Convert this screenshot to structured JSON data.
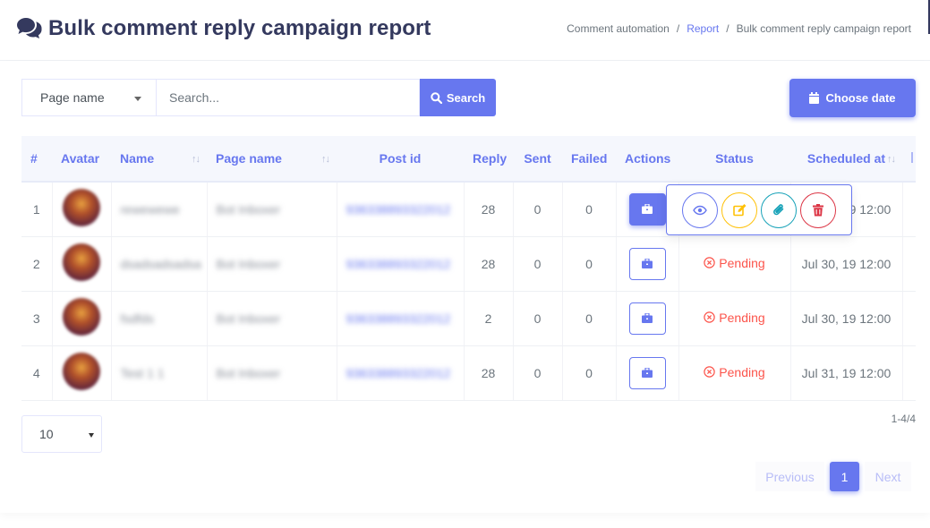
{
  "header": {
    "title": "Bulk comment reply campaign report",
    "title_icon": "comments-icon",
    "breadcrumb": [
      {
        "label": "Comment automation",
        "link": false
      },
      {
        "label": "Report",
        "link": true
      },
      {
        "label": "Bulk comment reply campaign report",
        "link": false
      }
    ],
    "separator": "/"
  },
  "filters": {
    "page_select": "Page name",
    "search_placeholder": "Search...",
    "search_label": "Search",
    "date_label": "Choose date"
  },
  "table": {
    "columns": [
      "#",
      "Avatar",
      "Name",
      "Page name",
      "Post id",
      "Reply",
      "Sent",
      "Failed",
      "Actions",
      "Status",
      "Scheduled at"
    ],
    "rows": [
      {
        "num": "1",
        "name": "rewewewe",
        "page": "Bot Inboxer",
        "post_id": "936338893322012",
        "reply": "28",
        "sent": "0",
        "failed": "0",
        "status": "",
        "scheduled": "Jul 30, 19 12:00"
      },
      {
        "num": "2",
        "name": "dsadsadsadsa",
        "page": "Bot Inboxer",
        "post_id": "936338893322012",
        "reply": "28",
        "sent": "0",
        "failed": "0",
        "status": "Pending",
        "scheduled": "Jul 30, 19 12:00"
      },
      {
        "num": "3",
        "name": "fsdfds",
        "page": "Bot Inboxer",
        "post_id": "936338893322012",
        "reply": "2",
        "sent": "0",
        "failed": "0",
        "status": "Pending",
        "scheduled": "Jul 30, 19 12:00"
      },
      {
        "num": "4",
        "name": "Test 1 1",
        "page": "Bot Inboxer",
        "post_id": "936338893322012",
        "reply": "28",
        "sent": "0",
        "failed": "0",
        "status": "Pending",
        "scheduled": "Jul 31, 19 12:00"
      }
    ]
  },
  "popover_actions": [
    {
      "icon": "eye-icon",
      "color": "#6777ef"
    },
    {
      "icon": "edit-icon",
      "color": "#ffc107"
    },
    {
      "icon": "paperclip-icon",
      "color": "#17a2b8"
    },
    {
      "icon": "trash-icon",
      "color": "#dc3545"
    }
  ],
  "pagination": {
    "per_page": "10",
    "count": "1-4/4",
    "previous": "Previous",
    "current": "1",
    "next": "Next"
  },
  "colors": {
    "primary": "#6777ef",
    "danger": "#fc544b",
    "heading": "#34395e"
  }
}
